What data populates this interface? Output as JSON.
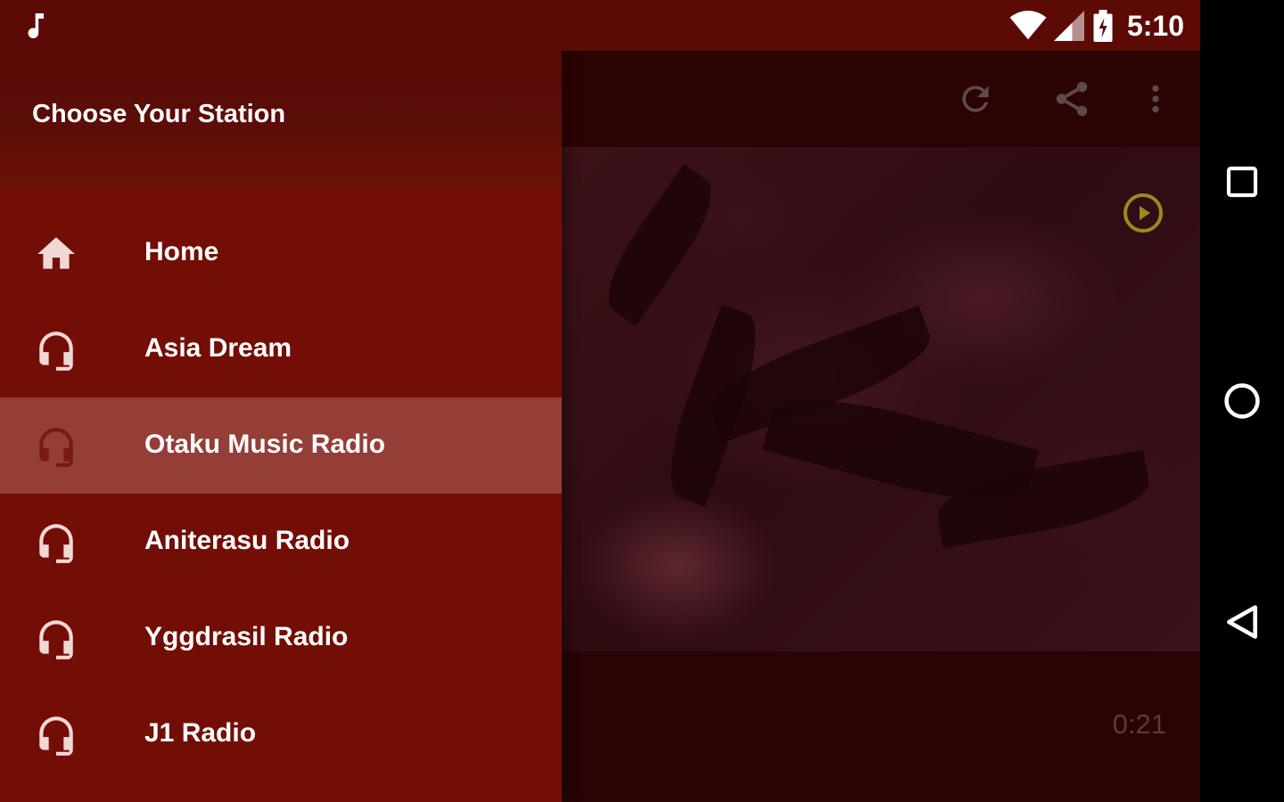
{
  "status_bar": {
    "time": "5:10",
    "icons": [
      "music-note-icon",
      "wifi-icon",
      "cell-signal-icon",
      "battery-charging-icon"
    ]
  },
  "drawer": {
    "header_title": "Choose Your Station",
    "items": [
      {
        "label": "Home",
        "icon": "home-icon",
        "active": false
      },
      {
        "label": "Asia Dream",
        "icon": "headphones-icon",
        "active": false
      },
      {
        "label": "Otaku Music Radio",
        "icon": "headphones-icon",
        "active": true
      },
      {
        "label": "Aniterasu Radio",
        "icon": "headphones-icon",
        "active": false
      },
      {
        "label": "Yggdrasil Radio",
        "icon": "headphones-icon",
        "active": false
      },
      {
        "label": "J1 Radio",
        "icon": "headphones-icon",
        "active": false
      }
    ]
  },
  "toolbar": {
    "actions": [
      "refresh-icon",
      "share-icon",
      "more-vert-icon"
    ]
  },
  "player": {
    "elapsed": "0:21",
    "play_icon": "play-circle-icon"
  },
  "system_nav": {
    "buttons": [
      "recents-icon",
      "home-circle-icon",
      "back-icon"
    ]
  },
  "colors": {
    "drawer_bg": "#730e06",
    "active_item_bg": "#953d37",
    "status_bar_bg": "#5c0a06",
    "accent_play": "#9a8a1a"
  }
}
